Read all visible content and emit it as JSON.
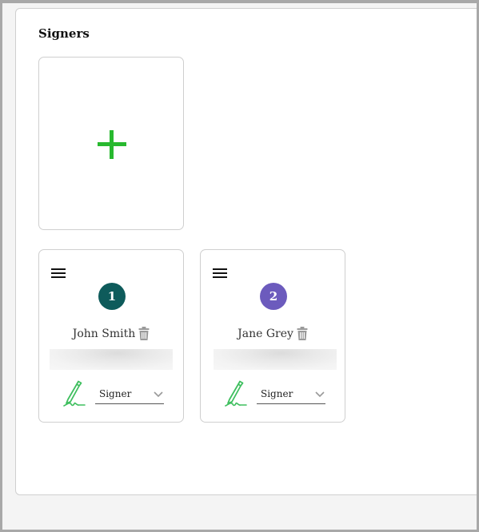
{
  "section": {
    "title": "Signers"
  },
  "add_card": {
    "icon": "plus-icon",
    "color": "#28b92f"
  },
  "signers": [
    {
      "number": "1",
      "name": "John Smith",
      "role": "Signer",
      "badge_color": "#0e5b5b"
    },
    {
      "number": "2",
      "name": "Jane Grey",
      "role": "Signer",
      "badge_color": "#6c5bbd"
    }
  ],
  "colors": {
    "pen": "#3fbf5f",
    "trash": "#9a9a9a",
    "chevron": "#999999"
  }
}
